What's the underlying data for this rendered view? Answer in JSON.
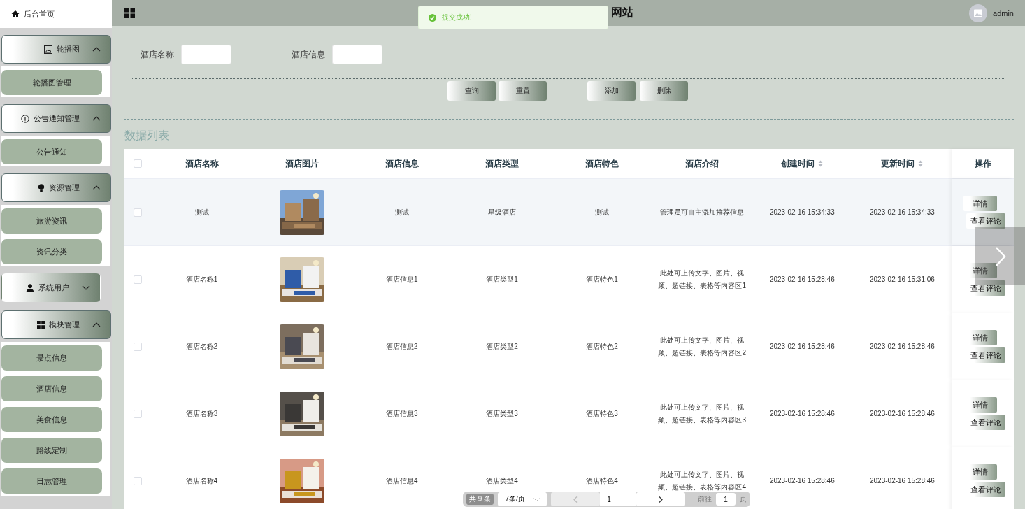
{
  "sidebar": {
    "home": {
      "label": "后台首页"
    },
    "groups": [
      {
        "label": "轮播图",
        "expanded": true,
        "children": [
          {
            "label": "轮播图管理"
          }
        ]
      },
      {
        "label": "公告通知管理",
        "expanded": true,
        "children": [
          {
            "label": "公告通知"
          }
        ]
      },
      {
        "label": "资源管理",
        "expanded": true,
        "children": [
          {
            "label": "旅游资讯"
          },
          {
            "label": "资讯分类"
          }
        ]
      },
      {
        "label": "系统用户",
        "expanded": false
      },
      {
        "label": "模块管理",
        "expanded": true,
        "children": [
          {
            "label": "景点信息"
          },
          {
            "label": "酒店信息"
          },
          {
            "label": "美食信息"
          },
          {
            "label": "路线定制"
          },
          {
            "label": "日志管理"
          }
        ]
      }
    ]
  },
  "header": {
    "title": "网站",
    "user": "admin"
  },
  "toast": {
    "message": "提交成功!"
  },
  "search": {
    "fields": [
      {
        "label": "酒店名称"
      },
      {
        "label": "酒店信息"
      }
    ],
    "buttons": [
      {
        "label": "查询"
      },
      {
        "label": "重置"
      }
    ],
    "actions": [
      {
        "label": "添加"
      },
      {
        "label": "删除"
      }
    ]
  },
  "list_title": "数据列表",
  "table": {
    "select_all": {
      "checked": false
    },
    "columns": [
      {
        "label": "酒店名称",
        "sortable": false
      },
      {
        "label": "酒店图片",
        "sortable": false
      },
      {
        "label": "酒店信息",
        "sortable": false
      },
      {
        "label": "酒店类型",
        "sortable": false
      },
      {
        "label": "酒店特色",
        "sortable": false
      },
      {
        "label": "酒店介绍",
        "sortable": false
      },
      {
        "label": "创建时间",
        "sortable": true
      },
      {
        "label": "更新时间",
        "sortable": true
      }
    ],
    "action_column": "操作",
    "rows": [
      {
        "checked": false,
        "highlighted": true,
        "name": "测试",
        "info": "测试",
        "type": "星级酒店",
        "feature": "测试",
        "intro": "管理员可自主添加推荐信息",
        "created": "2023-02-16 15:34:33",
        "updated": "2023-02-16 15:34:33",
        "actions": [
          "详情",
          "查看评论"
        ]
      },
      {
        "checked": false,
        "highlighted": false,
        "name": "酒店名称1",
        "info": "酒店信息1",
        "type": "酒店类型1",
        "feature": "酒店特色1",
        "intro": "此处可上传文字、图片、视频、超链接、表格等内容区1",
        "created": "2023-02-16 15:28:46",
        "updated": "2023-02-16 15:31:06",
        "actions": [
          "详情",
          "查看评论"
        ]
      },
      {
        "checked": false,
        "highlighted": false,
        "name": "酒店名称2",
        "info": "酒店信息2",
        "type": "酒店类型2",
        "feature": "酒店特色2",
        "intro": "此处可上传文字、图片、视频、超链接、表格等内容区2",
        "created": "2023-02-16 15:28:46",
        "updated": "2023-02-16 15:28:46",
        "actions": [
          "详情",
          "查看评论"
        ]
      },
      {
        "checked": false,
        "highlighted": false,
        "name": "酒店名称3",
        "info": "酒店信息3",
        "type": "酒店类型3",
        "feature": "酒店特色3",
        "intro": "此处可上传文字、图片、视频、超链接、表格等内容区3",
        "created": "2023-02-16 15:28:46",
        "updated": "2023-02-16 15:28:46",
        "actions": [
          "详情",
          "查看评论"
        ]
      },
      {
        "checked": false,
        "highlighted": false,
        "name": "酒店名称4",
        "info": "酒店信息4",
        "type": "酒店类型4",
        "feature": "酒店特色4",
        "intro": "此处可上传文字、图片、视频、超链接、表格等内容区4",
        "created": "2023-02-16 15:28:46",
        "updated": "2023-02-16 15:28:46",
        "actions": [
          "详情",
          "查看评论"
        ]
      }
    ]
  },
  "pagination": {
    "total": "共 9 条",
    "page_size": "7条/页",
    "prev_disabled": true,
    "current_page": "1",
    "goto_label": "前往",
    "goto_value": "1",
    "goto_suffix": "页"
  }
}
